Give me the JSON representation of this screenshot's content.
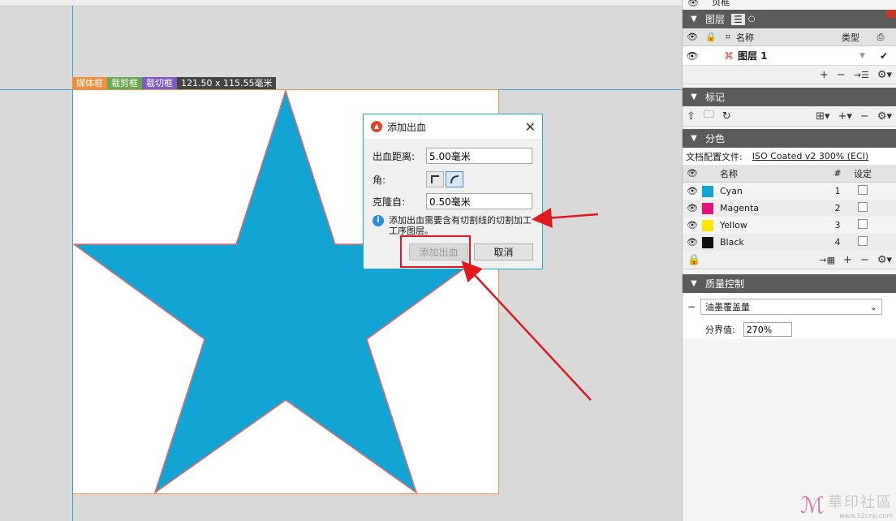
{
  "canvas": {
    "tabs": {
      "media": "媒体框",
      "crop": "裁剪框",
      "trim": "裁切框",
      "size": "121.50 x 115.55毫米"
    },
    "colors": {
      "star_fill": "#12a5d4",
      "star_stroke": "#e06a6a",
      "page_border": "#e4934d",
      "guide": "#3aa0d8",
      "annotation": "#e0191e"
    }
  },
  "dialog": {
    "title": "添加出血",
    "bleed_label": "出血距离:",
    "bleed_value": "5.00毫米",
    "corner_label": "角:",
    "corner_options": [
      "square-corner-icon",
      "round-corner-icon"
    ],
    "clone_label": "克隆自:",
    "clone_value": "0.50毫米",
    "info_text": "添加出血需要含有切割线的切割加工工序图层。",
    "add_button": "添加出血",
    "cancel_button": "取消"
  },
  "panel": {
    "top_partial": "页框",
    "layers": {
      "title": "图层",
      "col_name": "名称",
      "col_type": "类型",
      "layer_name": "图层 1"
    },
    "marks": {
      "title": "标记"
    },
    "separations": {
      "title": "分色",
      "profile_label": "文档配置文件:",
      "profile_value": "ISO Coated v2 300% (ECI)",
      "col_name": "名称",
      "col_num": "#",
      "col_setting": "设定",
      "inks": [
        {
          "name": "Cyan",
          "num": "1",
          "color": "#12a5d4"
        },
        {
          "name": "Magenta",
          "num": "2",
          "color": "#e2127a"
        },
        {
          "name": "Yellow",
          "num": "3",
          "color": "#ffe500"
        },
        {
          "name": "Black",
          "num": "4",
          "color": "#111111"
        }
      ]
    },
    "qc": {
      "title": "质量控制",
      "select_value": "油墨覆盖量",
      "limit_label": "分界值:",
      "limit_value": "270%"
    }
  },
  "watermark": {
    "text": "華印社區",
    "url": "www.52cnp.com"
  }
}
